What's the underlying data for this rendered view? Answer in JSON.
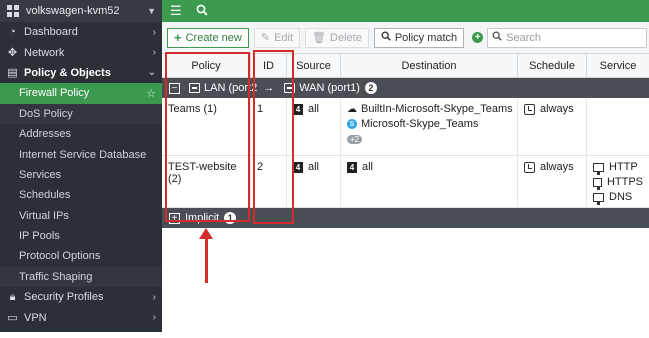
{
  "device": {
    "name": "volkswagen-kvm52"
  },
  "sidebar": {
    "items": [
      {
        "label": "Dashboard",
        "icon": "dashboard-icon"
      },
      {
        "label": "Network",
        "icon": "network-icon"
      },
      {
        "label": "Policy & Objects",
        "icon": "policy-icon"
      },
      {
        "label": "Firewall Policy"
      },
      {
        "label": "DoS Policy"
      },
      {
        "label": "Addresses"
      },
      {
        "label": "Internet Service Database"
      },
      {
        "label": "Services"
      },
      {
        "label": "Schedules"
      },
      {
        "label": "Virtual IPs"
      },
      {
        "label": "IP Pools"
      },
      {
        "label": "Protocol Options"
      },
      {
        "label": "Traffic Shaping"
      },
      {
        "label": "Security Profiles",
        "icon": "lock-icon"
      },
      {
        "label": "VPN",
        "icon": "monitor-icon"
      }
    ]
  },
  "toolbar": {
    "create_label": "Create new",
    "edit_label": "Edit",
    "delete_label": "Delete",
    "policy_match_label": "Policy match",
    "search_placeholder": "Search"
  },
  "table": {
    "headers": [
      "Policy",
      "ID",
      "Source",
      "Destination",
      "Schedule",
      "Service"
    ],
    "group": {
      "label": "LAN (port2",
      "arrow": "→",
      "dest": "WAN (port1)",
      "count": "2"
    },
    "rows": [
      {
        "policy": "Teams (1)",
        "id": "1",
        "source": "all",
        "destinations": [
          "BuiltIn-Microsoft-Skype_Teams",
          "Microsoft-Skype_Teams"
        ],
        "more": "+2",
        "schedule": "always",
        "services": []
      },
      {
        "policy": "TEST-website (2)",
        "id": "2",
        "source": "all",
        "destinations": [
          "all"
        ],
        "schedule": "always",
        "services": [
          "HTTP",
          "HTTPS",
          "DNS"
        ]
      }
    ],
    "implicit": {
      "label": "Implicit",
      "count": "1"
    }
  },
  "colors": {
    "accent": "#3c9a4f",
    "sidebar": "#2b3036",
    "annotation": "#d62b2b"
  }
}
